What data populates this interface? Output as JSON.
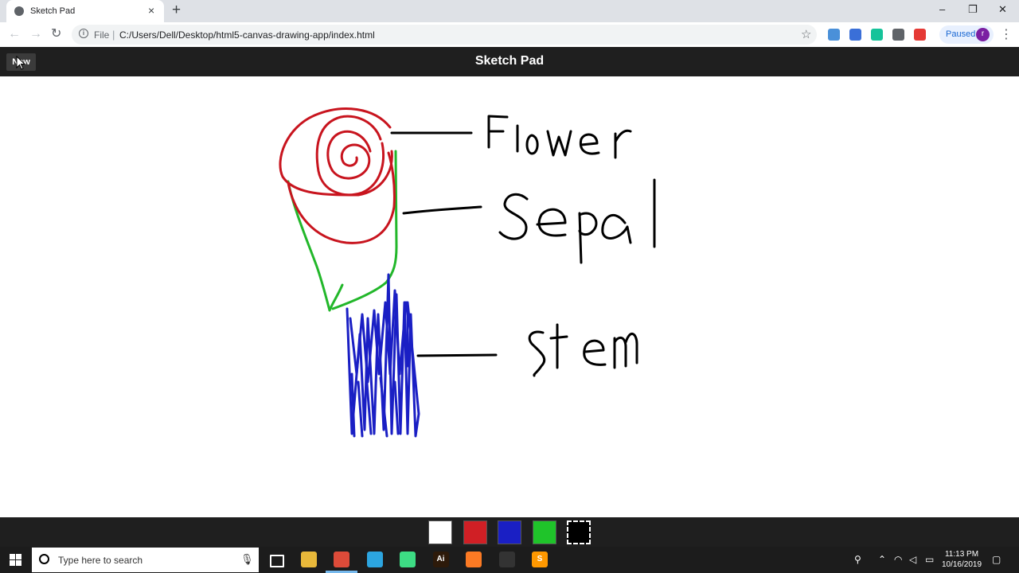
{
  "browser": {
    "tab_title": "Sketch Pad",
    "tab_close": "×",
    "new_tab": "+",
    "window_controls": {
      "minimize": "–",
      "maximize": "❐",
      "close": "✕"
    },
    "nav": {
      "back": "←",
      "forward": "→",
      "reload": "↻"
    },
    "omnibox": {
      "scheme_label": "File",
      "separator": "|",
      "url": "C:/Users/Dell/Desktop/html5-canvas-drawing-app/index.html",
      "info": "i",
      "star": "☆"
    },
    "profile": {
      "status": "Paused",
      "initial": "r"
    },
    "menu": "⋮",
    "extensions": [
      {
        "name": "screencastify-icon",
        "color": "#4a90d9"
      },
      {
        "name": "metamask-icon",
        "color": "#3a6fd8"
      },
      {
        "name": "grammarly-icon",
        "color": "#15c39a"
      },
      {
        "name": "puzzle-extension-icon",
        "color": "#5f6368"
      },
      {
        "name": "adblock-icon",
        "color": "#e53935"
      }
    ]
  },
  "app": {
    "new_button": "New",
    "title": "Sketch Pad",
    "palette": [
      {
        "name": "white",
        "color": "#ffffff",
        "selected": false
      },
      {
        "name": "red",
        "color": "#d01f25",
        "selected": false
      },
      {
        "name": "blue",
        "color": "#1a1fc4",
        "selected": false
      },
      {
        "name": "green",
        "color": "#1fc42a",
        "selected": false
      },
      {
        "name": "black",
        "color": "#000000",
        "selected": true
      }
    ],
    "drawing": {
      "stroke_colors": {
        "flower": "#c8141e",
        "sepal": "#22b72a",
        "stem": "#1a1fc4",
        "labels": "#000000"
      },
      "labels": [
        "Flower",
        "Sepal",
        "stem"
      ]
    }
  },
  "taskbar": {
    "search_placeholder": "Type here to search",
    "apps": [
      {
        "name": "task-view-icon",
        "label": "",
        "color": "transparent"
      },
      {
        "name": "file-explorer-icon",
        "label": "",
        "color": "#e8b83a"
      },
      {
        "name": "chrome-icon",
        "label": "",
        "color": "#dd4b39"
      },
      {
        "name": "telegram-icon",
        "label": "",
        "color": "#2ca5e0"
      },
      {
        "name": "android-studio-icon",
        "label": "",
        "color": "#3ddc84"
      },
      {
        "name": "illustrator-icon",
        "label": "Ai",
        "color": "#2d1a0a"
      },
      {
        "name": "xampp-icon",
        "label": "",
        "color": "#fb7a24"
      },
      {
        "name": "obs-icon",
        "label": "",
        "color": "#333333"
      },
      {
        "name": "sublime-icon",
        "label": "S",
        "color": "#ff9800"
      }
    ],
    "clock": {
      "time": "11:13 PM",
      "date": "10/16/2019"
    }
  }
}
